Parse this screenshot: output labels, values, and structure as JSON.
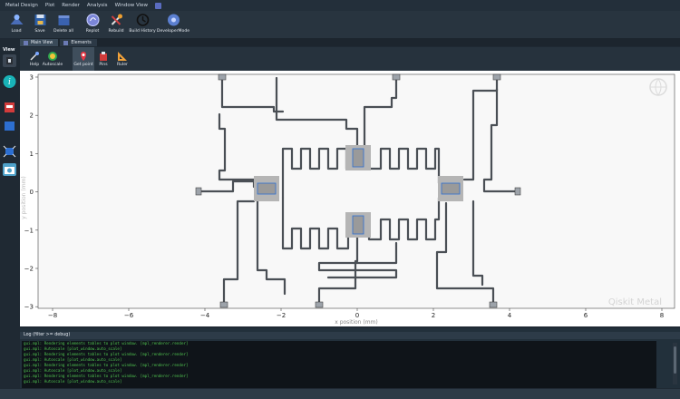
{
  "menu": [
    "Metal Design",
    "Plot",
    "Render",
    "Analysis",
    "Window View"
  ],
  "toolbar": [
    {
      "label": "Load",
      "icon": "load-icon"
    },
    {
      "label": "Save",
      "icon": "save-icon"
    },
    {
      "label": "Delete all",
      "icon": "delete-all-icon"
    },
    {
      "label": "Replot",
      "icon": "replot-icon"
    },
    {
      "label": "Rebuild",
      "icon": "rebuild-icon"
    },
    {
      "label": "Build History",
      "icon": "history-icon"
    },
    {
      "label": "DeveloperMode",
      "icon": "developer-mode-icon"
    }
  ],
  "tabs": [
    {
      "label": "Main View"
    },
    {
      "label": "Elements"
    }
  ],
  "left_panel": {
    "label": "View"
  },
  "subtoolbar": [
    {
      "label": "Help",
      "icon": "help-icon"
    },
    {
      "label": "Autoscale",
      "icon": "autoscale-icon"
    },
    {
      "label": "Get point",
      "icon": "get-point-icon"
    },
    {
      "label": "Pins",
      "icon": "pins-icon"
    },
    {
      "label": "Ruler",
      "icon": "ruler-icon"
    }
  ],
  "plot": {
    "xlabel": "x position (mm)",
    "ylabel": "y position (mm)",
    "xticks": [
      "−8",
      "−6",
      "−4",
      "−2",
      "0",
      "2",
      "4",
      "6",
      "8"
    ],
    "yticks": [
      "3",
      "2",
      "1",
      "0",
      "−1",
      "−2",
      "−3"
    ],
    "watermark": "Qiskit Metal"
  },
  "log": {
    "title": "Log  (filter >= debug)",
    "lines": [
      "gui.mpl: Rendering elements tables to plot window. [mpl_renderer.render]",
      "gui.mpl: Autoscale [plot_window.auto_scale]",
      "gui.mpl: Rendering elements tables to plot window. [mpl_renderer.render]",
      "gui.mpl: Autoscale [plot_window.auto_scale]",
      "gui.mpl: Rendering elements tables to plot window. [mpl_renderer.render]",
      "gui.mpl: Autoscale [plot_window.auto_scale]",
      "gui.mpl: Rendering elements tables to plot window. [mpl_renderer.render]",
      "gui.mpl: Autoscale [plot_window.auto_scale]"
    ]
  },
  "colors": {
    "accent": "#3b7dd8",
    "log_text": "#4fc24f"
  }
}
